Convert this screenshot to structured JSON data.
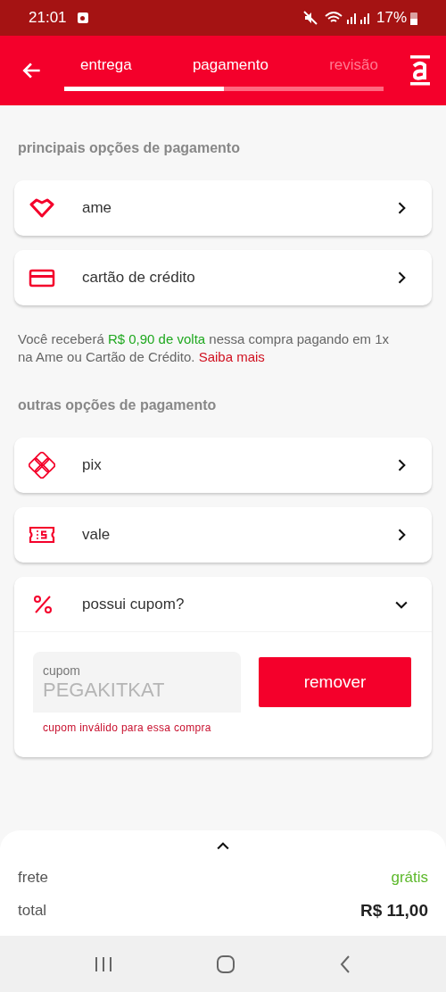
{
  "status_bar": {
    "time": "21:01",
    "battery": "17%"
  },
  "steps": [
    {
      "label": "entrega",
      "active": true
    },
    {
      "label": "pagamento",
      "active": true
    },
    {
      "label": "revisão",
      "active": false
    }
  ],
  "progress": {
    "level": 0.5
  },
  "main_title": "principais opções de pagamento",
  "main_options": [
    {
      "kind": "heart",
      "label": "ame"
    },
    {
      "kind": "card",
      "label": "cartão de crédito"
    }
  ],
  "cashback_note": "Você receberá **R$ 0,90 de volta** nessa compra pagando em 1x na Ame ou Cartão de Crédito.",
  "cashback_link": "Saiba mais",
  "other_title": "outras opções de pagamento",
  "other_options": [
    {
      "kind": "pix",
      "label": "pix"
    },
    {
      "kind": "voucher",
      "label": "vale"
    }
  ],
  "coupon": {
    "label": "possui cupom?",
    "expanded": true,
    "field_label": "cupom",
    "value": "PEGAKITKAT",
    "error": "cupom inválido para essa compra",
    "button": "remover"
  },
  "summary": {
    "rows": [
      {
        "label": "frete",
        "value": "grátis",
        "kind": "free"
      },
      {
        "label": "total",
        "value": "R$ 11,00",
        "kind": "total"
      }
    ]
  }
}
